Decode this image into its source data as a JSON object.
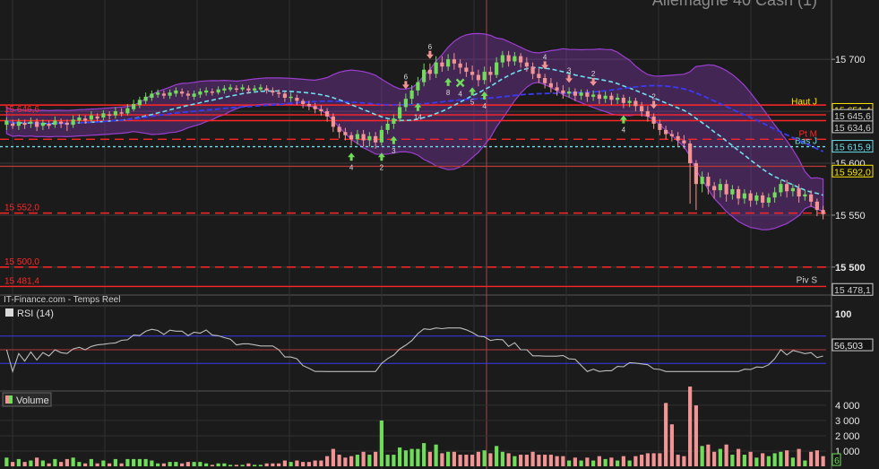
{
  "title": "Allemagne 40 Cash (1)",
  "source": "IT-Finance.com - Temps Reel",
  "colors": {
    "bg": "#1b1b1b",
    "grid": "#3a3a3a",
    "up": "#6fdc5a",
    "down": "#f29494",
    "band": "#9b3fd0",
    "red_line": "#ff2626",
    "cyan": "#6fe0ee",
    "blue": "#3a3af0",
    "yellow": "#ffe600"
  },
  "chart_data": [
    {
      "type": "candlestick",
      "name": "price",
      "y_axis": {
        "ticks": [
          {
            "value": 15700,
            "label": "15 700"
          },
          {
            "value": 15650,
            "label": "15 650"
          },
          {
            "value": 15600,
            "label": "15 600"
          },
          {
            "value": 15550,
            "label": "15 550"
          },
          {
            "value": 15500,
            "label": "15 500"
          }
        ],
        "ylim": [
          15474,
          15745
        ]
      },
      "price_tags": [
        {
          "value": 15651.4,
          "label": "15 651,4",
          "color": "#ffe600"
        },
        {
          "value": 15645.6,
          "label": "15 645,6",
          "color": "#cfcfcf"
        },
        {
          "value": 15634.6,
          "label": "15 634,6",
          "color": "#cfcfcf"
        },
        {
          "value": 15615.9,
          "label": "15 615,9",
          "color": "#6fe0ee"
        },
        {
          "value": 15592.0,
          "label": "15 592,0",
          "color": "#ffe600"
        },
        {
          "value": 15478.1,
          "label": "15 478,1",
          "color": "#cfcfcf"
        }
      ],
      "levels": [
        {
          "value": 15646.6,
          "label": "15 646,6",
          "style": "solid",
          "color": "#ff2626"
        },
        {
          "value": 15656.0,
          "label": "",
          "style": "solid",
          "color": "#ff2626"
        },
        {
          "value": 15641.0,
          "label": "",
          "style": "solid",
          "color": "#ff2626"
        },
        {
          "value": 15623.0,
          "label": "Pt M",
          "style": "dashed",
          "color": "#ff2626"
        },
        {
          "value": 15615.9,
          "label": "Bas J",
          "style": "dotted",
          "color": "#6fe0ee"
        },
        {
          "value": 15597.0,
          "label": "",
          "style": "solid",
          "color": "#b03a3a"
        },
        {
          "value": 15552.0,
          "label": "15 552,0",
          "style": "dashed",
          "color": "#ff2626"
        },
        {
          "value": 15500.0,
          "label": "15 500,0",
          "style": "dashed",
          "color": "#ff2626"
        },
        {
          "value": 15481.4,
          "label": "15 481,4",
          "style": "solid",
          "color": "#ff2626"
        }
      ],
      "line_labels": [
        {
          "value": 15655.0,
          "label": "Haut J",
          "color": "#ffe600"
        },
        {
          "value": 15483.0,
          "label": "Piv S",
          "color": "#cfcfcf"
        }
      ],
      "candles": [
        [
          15637,
          15641,
          15632,
          15644
        ],
        [
          15638,
          15636,
          15633,
          15642
        ],
        [
          15636,
          15640,
          15632,
          15643
        ],
        [
          15639,
          15637,
          15633,
          15642
        ],
        [
          15638,
          15640,
          15634,
          15644
        ],
        [
          15640,
          15635,
          15631,
          15643
        ],
        [
          15636,
          15639,
          15632,
          15642
        ],
        [
          15638,
          15636,
          15633,
          15641
        ],
        [
          15637,
          15641,
          15634,
          15645
        ],
        [
          15640,
          15638,
          15634,
          15643
        ],
        [
          15639,
          15637,
          15631,
          15642
        ],
        [
          15637,
          15642,
          15634,
          15646
        ],
        [
          15641,
          15644,
          15638,
          15647
        ],
        [
          15643,
          15641,
          15638,
          15646
        ],
        [
          15642,
          15646,
          15639,
          15650
        ],
        [
          15645,
          15643,
          15640,
          15648
        ],
        [
          15644,
          15648,
          15641,
          15651
        ],
        [
          15647,
          15646,
          15642,
          15650
        ],
        [
          15646,
          15650,
          15643,
          15654
        ],
        [
          15649,
          15648,
          15645,
          15653
        ],
        [
          15648,
          15653,
          15646,
          15657
        ],
        [
          15652,
          15657,
          15650,
          15661
        ],
        [
          15656,
          15661,
          15653,
          15664
        ],
        [
          15660,
          15664,
          15657,
          15668
        ],
        [
          15663,
          15667,
          15660,
          15670
        ],
        [
          15666,
          15668,
          15663,
          15671
        ],
        [
          15667,
          15665,
          15662,
          15670
        ],
        [
          15665,
          15668,
          15662,
          15671
        ],
        [
          15667,
          15670,
          15664,
          15673
        ],
        [
          15669,
          15667,
          15664,
          15672
        ],
        [
          15667,
          15665,
          15661,
          15670
        ],
        [
          15664,
          15667,
          15661,
          15670
        ],
        [
          15666,
          15669,
          15663,
          15672
        ],
        [
          15668,
          15670,
          15665,
          15673
        ],
        [
          15669,
          15668,
          15665,
          15672
        ],
        [
          15668,
          15671,
          15666,
          15674
        ],
        [
          15670,
          15672,
          15667,
          15675
        ],
        [
          15671,
          15673,
          15669,
          15676
        ],
        [
          15672,
          15671,
          15668,
          15675
        ],
        [
          15671,
          15673,
          15669,
          15676
        ],
        [
          15672,
          15670,
          15667,
          15675
        ],
        [
          15670,
          15672,
          15668,
          15675
        ],
        [
          15671,
          15673,
          15669,
          15676
        ],
        [
          15672,
          15670,
          15667,
          15675
        ],
        [
          15670,
          15668,
          15665,
          15673
        ],
        [
          15668,
          15667,
          15663,
          15671
        ],
        [
          15667,
          15663,
          15659,
          15669
        ],
        [
          15663,
          15664,
          15659,
          15668
        ],
        [
          15663,
          15660,
          15656,
          15666
        ],
        [
          15660,
          15657,
          15653,
          15662
        ],
        [
          15657,
          15655,
          15651,
          15660
        ],
        [
          15655,
          15652,
          15648,
          15658
        ],
        [
          15652,
          15650,
          15646,
          15656
        ],
        [
          15650,
          15645,
          15640,
          15653
        ],
        [
          15645,
          15635,
          15630,
          15648
        ],
        [
          15635,
          15630,
          15624,
          15638
        ],
        [
          15630,
          15627,
          15622,
          15634
        ],
        [
          15627,
          15623,
          15617,
          15630
        ],
        [
          15623,
          15628,
          15618,
          15632
        ],
        [
          15628,
          15622,
          15616,
          15632
        ],
        [
          15622,
          15626,
          15616,
          15630
        ],
        [
          15626,
          15620,
          15614,
          15630
        ],
        [
          15620,
          15632,
          15617,
          15636
        ],
        [
          15632,
          15638,
          15628,
          15642
        ],
        [
          15638,
          15643,
          15633,
          15647
        ],
        [
          15643,
          15654,
          15640,
          15659
        ],
        [
          15654,
          15662,
          15650,
          15667
        ],
        [
          15662,
          15670,
          15657,
          15675
        ],
        [
          15670,
          15678,
          15665,
          15683
        ],
        [
          15678,
          15690,
          15674,
          15696
        ],
        [
          15690,
          15686,
          15680,
          15696
        ],
        [
          15686,
          15697,
          15682,
          15703
        ],
        [
          15697,
          15693,
          15688,
          15703
        ],
        [
          15693,
          15700,
          15689,
          15705
        ],
        [
          15700,
          15696,
          15690,
          15706
        ],
        [
          15696,
          15692,
          15686,
          15700
        ],
        [
          15692,
          15688,
          15683,
          15697
        ],
        [
          15688,
          15685,
          15680,
          15694
        ],
        [
          15685,
          15680,
          15674,
          15690
        ],
        [
          15680,
          15688,
          15676,
          15693
        ],
        [
          15688,
          15685,
          15678,
          15693
        ],
        [
          15685,
          15697,
          15682,
          15702
        ],
        [
          15697,
          15704,
          15692,
          15708
        ],
        [
          15704,
          15698,
          15693,
          15708
        ],
        [
          15698,
          15703,
          15694,
          15707
        ],
        [
          15703,
          15697,
          15692,
          15706
        ],
        [
          15697,
          15693,
          15688,
          15702
        ],
        [
          15693,
          15686,
          15681,
          15697
        ],
        [
          15686,
          15682,
          15677,
          15691
        ],
        [
          15682,
          15677,
          15672,
          15686
        ],
        [
          15677,
          15673,
          15668,
          15682
        ],
        [
          15673,
          15670,
          15665,
          15678
        ],
        [
          15670,
          15667,
          15662,
          15675
        ],
        [
          15667,
          15669,
          15663,
          15673
        ],
        [
          15669,
          15665,
          15660,
          15672
        ],
        [
          15665,
          15668,
          15661,
          15671
        ],
        [
          15668,
          15664,
          15659,
          15671
        ],
        [
          15664,
          15666,
          15660,
          15670
        ],
        [
          15666,
          15662,
          15657,
          15670
        ],
        [
          15662,
          15665,
          15658,
          15669
        ],
        [
          15665,
          15661,
          15656,
          15668
        ],
        [
          15661,
          15663,
          15657,
          15667
        ],
        [
          15663,
          15658,
          15653,
          15666
        ],
        [
          15658,
          15660,
          15654,
          15664
        ],
        [
          15660,
          15655,
          15650,
          15663
        ],
        [
          15655,
          15650,
          15645,
          15659
        ],
        [
          15650,
          15645,
          15640,
          15655
        ],
        [
          15645,
          15638,
          15633,
          15648
        ],
        [
          15638,
          15632,
          15627,
          15642
        ],
        [
          15632,
          15628,
          15623,
          15636
        ],
        [
          15628,
          15626,
          15621,
          15632
        ],
        [
          15626,
          15622,
          15616,
          15630
        ],
        [
          15622,
          15619,
          15614,
          15627
        ],
        [
          15619,
          15600,
          15561,
          15622
        ],
        [
          15600,
          15580,
          15555,
          15603
        ],
        [
          15580,
          15587,
          15572,
          15592
        ],
        [
          15587,
          15578,
          15570,
          15591
        ],
        [
          15578,
          15574,
          15566,
          15582
        ],
        [
          15574,
          15580,
          15567,
          15585
        ],
        [
          15580,
          15570,
          15563,
          15584
        ],
        [
          15570,
          15575,
          15565,
          15579
        ],
        [
          15575,
          15566,
          15560,
          15578
        ],
        [
          15566,
          15571,
          15561,
          15575
        ],
        [
          15571,
          15564,
          15558,
          15574
        ],
        [
          15564,
          15569,
          15560,
          15572
        ],
        [
          15569,
          15562,
          15557,
          15572
        ],
        [
          15562,
          15567,
          15558,
          15571
        ],
        [
          15567,
          15572,
          15562,
          15577
        ],
        [
          15572,
          15580,
          15568,
          15584
        ],
        [
          15580,
          15573,
          15567,
          15584
        ],
        [
          15573,
          15576,
          15568,
          15580
        ],
        [
          15576,
          15568,
          15562,
          15580
        ],
        [
          15568,
          15570,
          15564,
          15574
        ],
        [
          15570,
          15563,
          15558,
          15574
        ],
        [
          15563,
          15555,
          15549,
          15566
        ],
        [
          15555,
          15551,
          15546,
          15559
        ]
      ]
    },
    {
      "type": "line",
      "name": "RSI (14)",
      "y_axis": {
        "ticks": [
          {
            "value": 100,
            "label": "100"
          }
        ],
        "ylim": [
          0,
          100
        ]
      },
      "levels": [
        70,
        30
      ],
      "current": {
        "value": 56.503,
        "label": "56,503"
      }
    },
    {
      "type": "bar",
      "name": "Volume",
      "y_axis": {
        "ticks": [
          {
            "value": 4000,
            "label": "4 000"
          },
          {
            "value": 3000,
            "label": "3 000"
          },
          {
            "value": 2000,
            "label": "2 000"
          },
          {
            "value": 1000,
            "label": "1 000"
          }
        ],
        "ylim": [
          0,
          4700
        ]
      },
      "current": {
        "label": "6"
      }
    }
  ],
  "signals": [
    {
      "index": 57,
      "dir": "up",
      "label": "4"
    },
    {
      "index": 62,
      "dir": "up",
      "label": "2"
    },
    {
      "index": 64,
      "dir": "up",
      "label": "3"
    },
    {
      "index": 66,
      "dir": "down",
      "label": "6"
    },
    {
      "index": 68,
      "dir": "up",
      "label": "14"
    },
    {
      "index": 70,
      "dir": "down",
      "label": "6"
    },
    {
      "index": 73,
      "dir": "up",
      "label": "8"
    },
    {
      "index": 75,
      "dir": "cross",
      "label": "4"
    },
    {
      "index": 77,
      "dir": "up",
      "label": "5"
    },
    {
      "index": 79,
      "dir": "up",
      "label": "4"
    },
    {
      "index": 89,
      "dir": "down",
      "label": "4"
    },
    {
      "index": 93,
      "dir": "down",
      "label": "3"
    },
    {
      "index": 97,
      "dir": "down",
      "label": "2"
    },
    {
      "index": 102,
      "dir": "up",
      "label": "4"
    },
    {
      "index": 107,
      "dir": "down",
      "label": "2"
    }
  ]
}
